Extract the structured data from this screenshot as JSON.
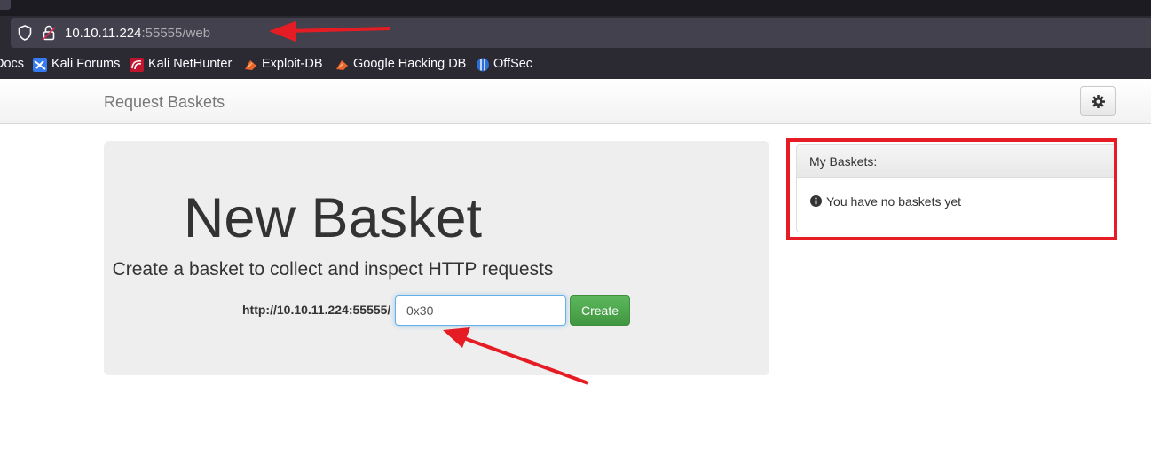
{
  "browser": {
    "url_host": "10.10.11.224",
    "url_rest": ":55555/web",
    "bookmarks": [
      {
        "label": "Docs"
      },
      {
        "label": "Kali Forums"
      },
      {
        "label": "Kali NetHunter"
      },
      {
        "label": "Exploit-DB"
      },
      {
        "label": "Google Hacking DB"
      },
      {
        "label": "OffSec"
      }
    ]
  },
  "navbar": {
    "brand": "Request Baskets",
    "settings_icon": "gear-icon"
  },
  "jumbotron": {
    "title": "New Basket",
    "subtitle": "Create a basket to collect and inspect HTTP requests",
    "base_url": "http://10.10.11.224:55555/",
    "input_value": "0x30",
    "create_label": "Create"
  },
  "panel": {
    "title": "My Baskets:",
    "empty_text": "You have no baskets yet",
    "info_icon": "info-circle-icon"
  },
  "colors": {
    "annotation_red": "#e51c23",
    "create_green": "#5cb85c",
    "browser_dark": "#2b2a33"
  }
}
